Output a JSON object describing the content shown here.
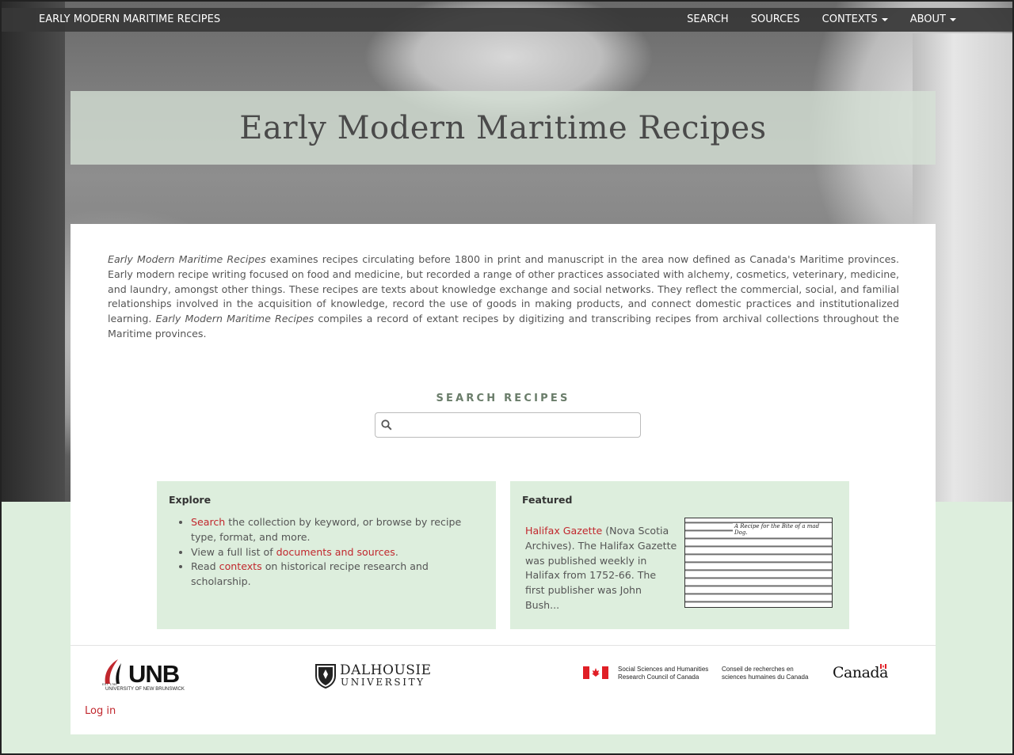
{
  "nav": {
    "brand": "EARLY MODERN MARITIME RECIPES",
    "links": [
      {
        "label": "SEARCH",
        "dropdown": false
      },
      {
        "label": "SOURCES",
        "dropdown": false
      },
      {
        "label": "CONTEXTS",
        "dropdown": true
      },
      {
        "label": "ABOUT",
        "dropdown": true
      }
    ]
  },
  "hero": {
    "title": "Early Modern Maritime Recipes"
  },
  "intro": {
    "italic_title": "Early Modern Maritime Recipes",
    "text_1": " examines recipes circulating before 1800 in print and manuscript in the area now defined as Canada's Maritime provinces. Early modern recipe writing focused on food and medicine, but recorded a range of other practices associated with alchemy, cosmetics, veterinary, medicine, and laundry, amongst other things. These recipes are texts about knowledge exchange and social networks. They reflect the commercial, social, and familial relationships involved in the acquisition of knowledge, record the use of goods in making products, and connect domestic practices and institutionalized learning. ",
    "text_2": " compiles a record of extant recipes by digitizing and transcribing recipes from archival collections throughout the Maritime provinces."
  },
  "search": {
    "label": "SEARCH RECIPES",
    "placeholder": "",
    "value": ""
  },
  "explore": {
    "heading": "Explore",
    "items": [
      {
        "link": "Search",
        "before": "",
        "after": " the collection by keyword, or browse by recipe type, format, and more."
      },
      {
        "link": "documents and sources",
        "before": "View a full list of ",
        "after": "."
      },
      {
        "link": "contexts",
        "before": "Read ",
        "after": " on historical recipe research and scholarship."
      }
    ]
  },
  "featured": {
    "heading": "Featured",
    "link": "Halifax Gazette",
    "text": " (Nova Scotia Archives). The Halifax Gazette was published weekly in Halifax from 1752-66. The first publisher was John Bush...",
    "thumb_heading": "A Recipe for the Bite of a mad Dog."
  },
  "footer": {
    "unb": {
      "name": "UNB",
      "sub": "UNIVERSITY OF NEW BRUNSWICK",
      "est": "EST. 1785"
    },
    "dal": {
      "line1": "DALHOUSIE",
      "line2": "UNIVERSITY"
    },
    "sshrc": {
      "en_1": "Social Sciences and Humanities",
      "en_2": "Research Council of Canada",
      "fr_1": "Conseil de recherches en",
      "fr_2": "sciences humaines du Canada"
    },
    "canada": "Canadä",
    "login": "Log in"
  },
  "colors": {
    "accent_link": "#c1272d",
    "navbar": "#373737",
    "page_bg": "#ddeedd",
    "title_band": "#d6e2d6"
  }
}
